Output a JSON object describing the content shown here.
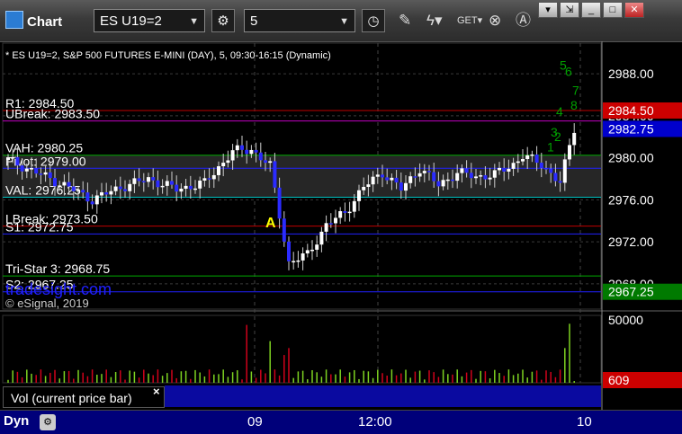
{
  "window": {
    "title": "Chart",
    "symbol": "ES U19=2",
    "interval": "5"
  },
  "chart_data": {
    "type": "candlestick",
    "header_text": "* ES U19=2, S&P 500 FUTURES E-MINI (DAY), 5, 09:30-16:15 (Dynamic)",
    "ylim": [
      2965.6,
      2990.4
    ],
    "y_ticks": [
      "2988.00",
      "2984.00",
      "2980.00",
      "2976.00",
      "2972.00",
      "2968.00"
    ],
    "x_ticks": [
      "09",
      "12:00",
      "10"
    ],
    "price_tags": [
      {
        "value": 2984.5,
        "label": "2984.50",
        "color": "#cc0000"
      },
      {
        "value": 2982.75,
        "label": "2982.75",
        "color": "#0000cc"
      },
      {
        "value": 2967.25,
        "label": "2967.25",
        "color": "#007a00"
      }
    ],
    "levels": [
      {
        "label": "R1: 2984.50",
        "value": 2984.5,
        "color": "#c00000"
      },
      {
        "label": "UBreak: 2983.50",
        "value": 2983.5,
        "color": "#c000c0"
      },
      {
        "label": "VAH: 2980.25",
        "value": 2980.25,
        "color": "#00aa00"
      },
      {
        "label": "Pivot: 2979.00",
        "value": 2979.0,
        "color": "#2020ff"
      },
      {
        "label": "VAL: 2976.25",
        "value": 2976.25,
        "color": "#00c0c0"
      },
      {
        "label": "LBreak: 2973.50",
        "value": 2973.5,
        "color": "#c00000"
      },
      {
        "label": "S1: 2972.75",
        "value": 2972.75,
        "color": "#2020ff"
      },
      {
        "label": "Tri-Star 3: 2968.75",
        "value": 2968.75,
        "color": "#00aa00"
      },
      {
        "label": "S2: 2967.25",
        "value": 2967.25,
        "color": "#2020ff"
      }
    ],
    "annotations": [
      {
        "text": "A",
        "color": "#ffff00",
        "value": 2973.4
      }
    ],
    "count_labels": [
      "5",
      "6",
      "7",
      "8",
      "4",
      "3",
      "2",
      "1"
    ],
    "watermark": "tradesight.com",
    "copyright": "© eSignal, 2019",
    "volume": {
      "label": "Vol (current price bar)",
      "y_ticks": [
        "50000"
      ],
      "current": "609",
      "ymax": 52000
    }
  },
  "status": {
    "mode": "Dyn"
  },
  "icons": {
    "settings": "gear-icon",
    "clock": "clock-icon",
    "draw": "pencil-icon",
    "studies": "studies-icon",
    "get": "get-icon",
    "close": "close-icon",
    "text": "text-icon"
  }
}
